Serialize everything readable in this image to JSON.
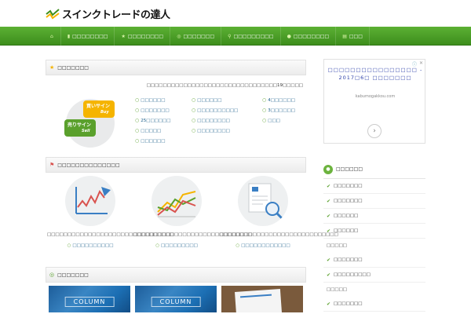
{
  "site": {
    "title": "スインクトレードの達人"
  },
  "nav": [
    {
      "icon": "home-icon",
      "label": ""
    },
    {
      "icon": "bar-chart-icon",
      "label": "□□□□□□□□"
    },
    {
      "icon": "star-icon",
      "label": "□□□□□□□□"
    },
    {
      "icon": "chat-icon",
      "label": "□□□□□□□"
    },
    {
      "icon": "search-icon",
      "label": "□□□□□□□□□"
    },
    {
      "icon": "globe-icon",
      "label": "□□□□□□□□"
    },
    {
      "icon": "book-icon",
      "label": "□□□"
    }
  ],
  "features": {
    "heading": "□□□□□□□",
    "description": "□□□□□□□□□□□□□□□□□□□□□□□□□□□□□□□□19□□□□□",
    "buy_label": "買いサイン",
    "buy_sub": "Buy",
    "sell_label": "売りサイン",
    "sell_sub": "Sell",
    "links": [
      [
        "□□□□□□",
        "□□□□□□",
        "4□□□□□□"
      ],
      [
        "□□□□□□□",
        "□□□□□□□□□□",
        "3□□□□□□"
      ],
      [
        "25□□□□□□",
        "□□□□□□□□",
        "□□□"
      ],
      [
        "□□□□□",
        "□□□□□□□□",
        ""
      ],
      [
        "□□□□□□",
        "",
        ""
      ]
    ]
  },
  "recommend": {
    "heading": "□□□□□□□□□□□□□□",
    "cards": [
      {
        "desc": "□□□□□□□□□□□□□□□□□□□□□□□□□□□□□□□",
        "link": "□□□□□□□□□□"
      },
      {
        "desc": "□□□□□□□□□□□□□□□□□□□□□□□□□□□□□",
        "link": "□□□□□□□□□"
      },
      {
        "desc": "□□□□□□□□□□□□□□□□□□□□□□□□□□□□□",
        "link": "□□□□□□□□□□□□"
      }
    ]
  },
  "column": {
    "heading": "□□□□□□□",
    "thumbs": [
      {
        "label": "COLUMN"
      },
      {
        "label": "COLUMN"
      }
    ]
  },
  "ad": {
    "title_line1": "□□□□□□□□□□□□□□□□ -",
    "title_line2": "2017□6□ □□□□□□□",
    "url": "kabumogakkou.com",
    "next": "›",
    "close": "✕",
    "info": "ⓘ"
  },
  "sidebar": {
    "category_heading": "□□□□□□",
    "items": [
      "□□□□□□□",
      "□□□□□□□",
      "□□□□□□",
      "□□□□□□"
    ],
    "sub1_heading": "□□□□□",
    "sub1_items": [
      "□□□□□□□",
      "□□□□□□□□□"
    ],
    "sub2_heading": "□□□□□",
    "sub2_items": [
      "□□□□□□□"
    ]
  },
  "colors": {
    "nav_green": "#4a9e26",
    "link_blue": "#1a5e8a",
    "accent_yellow": "#f5b400"
  }
}
